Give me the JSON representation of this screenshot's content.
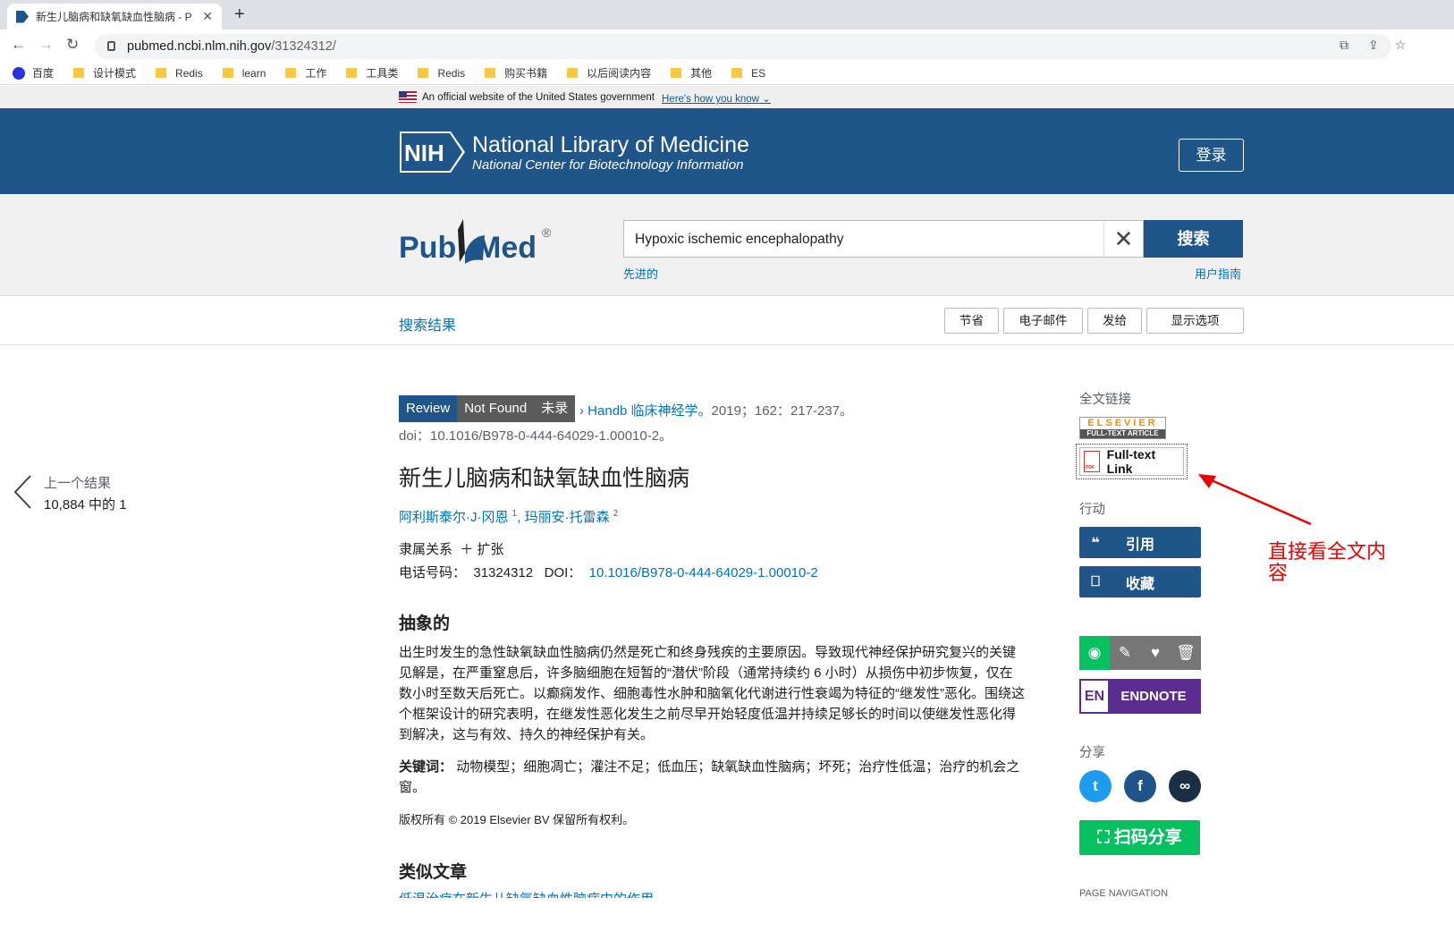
{
  "browser": {
    "tab_title": "新生儿脑病和缺氧缺血性脑病 - P",
    "url_host": "pubmed.ncbi.nlm.nih.gov",
    "url_path": "/31324312/",
    "bookmarks": [
      "百度",
      "设计模式",
      "Redis",
      "learn",
      "工作",
      "工具类",
      "Redis",
      "购买书籍",
      "以后阅读内容",
      "其他",
      "ES"
    ]
  },
  "gov_banner": {
    "text": "An official website of the United States government",
    "link": "Here's how you know"
  },
  "nih": {
    "logo": "NIH",
    "title": "National Library of Medicine",
    "subtitle": "National Center for Biotechnology Information",
    "login": "登录"
  },
  "search": {
    "logo_pub": "Pub",
    "logo_med": "Med",
    "query": "Hypoxic ischemic encephalopathy",
    "button": "搜索",
    "advanced": "先进的",
    "guide": "用户指南"
  },
  "actionbar": {
    "results": "搜索结果",
    "save": "节省",
    "email": "电子邮件",
    "send": "发给",
    "display": "显示选项"
  },
  "prev": {
    "label": "上一个结果",
    "count": "10,884 中的 1"
  },
  "article": {
    "tag_review": "Review",
    "tag_notfound": "Not Found",
    "tag_unrecorded": "未录",
    "journal": "Handb 临床神经学。",
    "citation": "2019；162：217-237。",
    "doi_line": "doi：10.1016/B978-0-444-64029-1.00010-2。",
    "title": "新生儿脑病和缺氧缺血性脑病",
    "author1": "阿利斯泰尔·J·冈恩",
    "author1_sup": "1",
    "author2": "玛丽安·托雷森",
    "author2_sup": "2",
    "affil": "隶属关系",
    "expand": "扩张",
    "pmid_label": "电话号码：",
    "pmid": "31324312",
    "doi_label": "DOI：",
    "doi": "10.1016/B978-0-444-64029-1.00010-2",
    "abstract_head": "抽象的",
    "abstract": "出生时发生的急性缺氧缺血性脑病仍然是死亡和终身残疾的主要原因。导致现代神经保护研究复兴的关键见解是，在严重窒息后，许多脑细胞在短暂的“潜伏”阶段（通常持续约 6 小时）从损伤中初步恢复，仅在数小时至数天后死亡。以癫痫发作、细胞毒性水肿和脑氧化代谢进行性衰竭为特征的“继发性”恶化。围绕这个框架设计的研究表明，在继发性恶化发生之前尽早开始轻度低温并持续足够长的时间以使继发性恶化得到解决，这与有效、持久的神经保护有关。",
    "keywords_label": "关键词：",
    "keywords": "动物模型；细胞凋亡；灌注不足；低血压；缺氧缺血性脑病；坏死；治疗性低温；治疗的机会之窗。",
    "copyright": "版权所有 © 2019 Elsevier BV 保留所有权利。",
    "similar_head": "类似文章",
    "similar_link": "低温治疗在新生儿缺氧缺血性脑病中的作用"
  },
  "sidebar": {
    "fulltext_head": "全文链接",
    "elsevier": "ELSEVIER",
    "elsevier_sub": "FULL-TEXT ARTICLE",
    "fulltext_link": "Full-text Link",
    "actions_head": "行动",
    "cite": "引用",
    "collect": "收藏",
    "endnote_en": "EN",
    "endnote": "ENDNOTE",
    "share_head": "分享",
    "qr_share": "扫码分享",
    "page_nav": "PAGE NAVIGATION"
  },
  "annotation": {
    "text": "直接看全文内容",
    "color": "#e00000"
  },
  "colors": {
    "nih_blue": "#20558a",
    "link": "#0071bc",
    "wechat": "#07c160",
    "endnote": "#5c2d91"
  }
}
